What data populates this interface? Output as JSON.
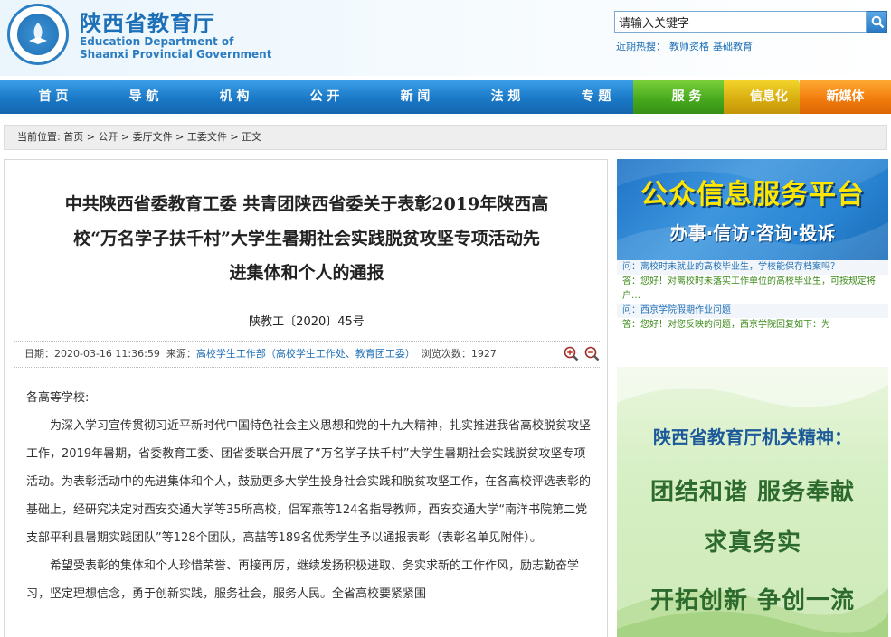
{
  "header": {
    "title_cn": "陕西省教育厅",
    "title_en_line1": "Education Department of",
    "title_en_line2": "Shaanxi Provincial Government",
    "search_value": "请输入关键字",
    "hot_label": "近期热搜：",
    "hot_words": [
      "教师资格",
      "基础教育"
    ]
  },
  "nav": {
    "items": [
      {
        "label": "首 页",
        "color": "blue"
      },
      {
        "label": "导 航",
        "color": "blue"
      },
      {
        "label": "机 构",
        "color": "blue"
      },
      {
        "label": "公 开",
        "color": "blue"
      },
      {
        "label": "新 闻",
        "color": "blue"
      },
      {
        "label": "法 规",
        "color": "blue"
      },
      {
        "label": "专 题",
        "color": "blue"
      },
      {
        "label": "服 务",
        "color": "green"
      },
      {
        "label": "信息化",
        "color": "yellow"
      },
      {
        "label": "新媒体",
        "color": "orange"
      }
    ]
  },
  "breadcrumb": "当前位置: 首页 > 公开 > 委厅文件 > 工委文件 > 正文",
  "article": {
    "title_line1": "中共陕西省委教育工委 共青团陕西省委关于表彰2019年陕西高",
    "title_line2": "校“万名学子扶千村”大学生暑期社会实践脱贫攻坚专项活动先",
    "title_line3": "进集体和个人的通报",
    "doc_no": "陕教工〔2020〕45号",
    "meta_date": "日期：2020-03-16 11:36:59",
    "meta_source_label": "来源：",
    "meta_source": "高校学生工作部（高校学生工作处、教育团工委）",
    "meta_views": "浏览次数：1927",
    "salutation": "各高等学校:",
    "para1": "为深入学习宣传贯彻习近平新时代中国特色社会主义思想和党的十九大精神，扎实推进我省高校脱贫攻坚工作，2019年暑期，省委教育工委、团省委联合开展了“万名学子扶千村”大学生暑期社会实践脱贫攻坚专项活动。为表彰活动中的先进集体和个人，鼓励更多大学生投身社会实践和脱贫攻坚工作，在各高校评选表彰的基础上，经研究决定对西安交通大学等35所高校，侣军燕等124名指导教师，西安交通大学“南洋书院第二党支部平利县暑期实践团队”等128个团队，高喆等189名优秀学生予以通报表彰（表彰名单见附件）。",
    "para2": "希望受表彰的集体和个人珍惜荣誉、再接再厉，继续发扬积极进取、务实求新的工作作风，励志勤奋学习，坚定理想信念，勇于创新实践，服务社会，服务人民。全省高校要紧紧围"
  },
  "sidebar": {
    "banner1_title": "公众信息服务平台",
    "banner1_sub": "办事·信访·咨询·投诉",
    "qa": [
      {
        "type": "q",
        "text": "问：离校时未就业的高校毕业生，学校能保存档案吗？"
      },
      {
        "type": "a",
        "text": "答：您好！对离校时未落实工作单位的高校毕业生，可按规定将户…"
      },
      {
        "type": "q",
        "text": "问：西京学院假期作业问题"
      },
      {
        "type": "a",
        "text": "答：您好！对您反映的问题，西京学院回复如下：为"
      }
    ],
    "banner2_title": "陕西省教育厅机关精神：",
    "banner2_lines": [
      "团结和谐  服务奉献",
      "求真务实",
      "开拓创新  争创一流"
    ]
  }
}
